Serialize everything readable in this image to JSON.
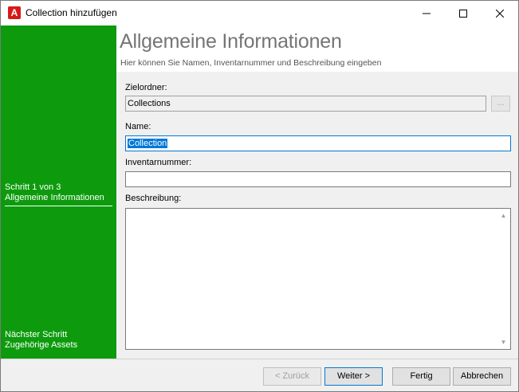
{
  "window": {
    "title": "Collection hinzufügen",
    "app_icon_letter": "A",
    "app_icon_color": "#d61a1a",
    "controls": {
      "minimize": "minimize-icon",
      "maximize": "maximize-icon",
      "close": "close-icon"
    }
  },
  "sidebar": {
    "accent_color": "#0d9b0d",
    "current_step": "Schritt 1 von 3",
    "current_step_name": "Allgemeine Informationen",
    "next_label": "Nächster Schritt",
    "next_step_name": "Zugehörige Assets"
  },
  "header": {
    "title": "Allgemeine Informationen",
    "subtitle": "Hier können Sie Namen, Inventarnummer und Beschreibung eingeben"
  },
  "form": {
    "target_folder_label": "Zielordner:",
    "target_folder_value": "Collections",
    "browse_label": "...",
    "name_label": "Name:",
    "name_value": "Collection",
    "inventory_label": "Inventarnummer:",
    "inventory_value": "",
    "description_label": "Beschreibung:",
    "description_value": ""
  },
  "buttons": {
    "back": "< Zurück",
    "next": "Weiter >",
    "finish": "Fertig",
    "cancel": "Abbrechen"
  }
}
